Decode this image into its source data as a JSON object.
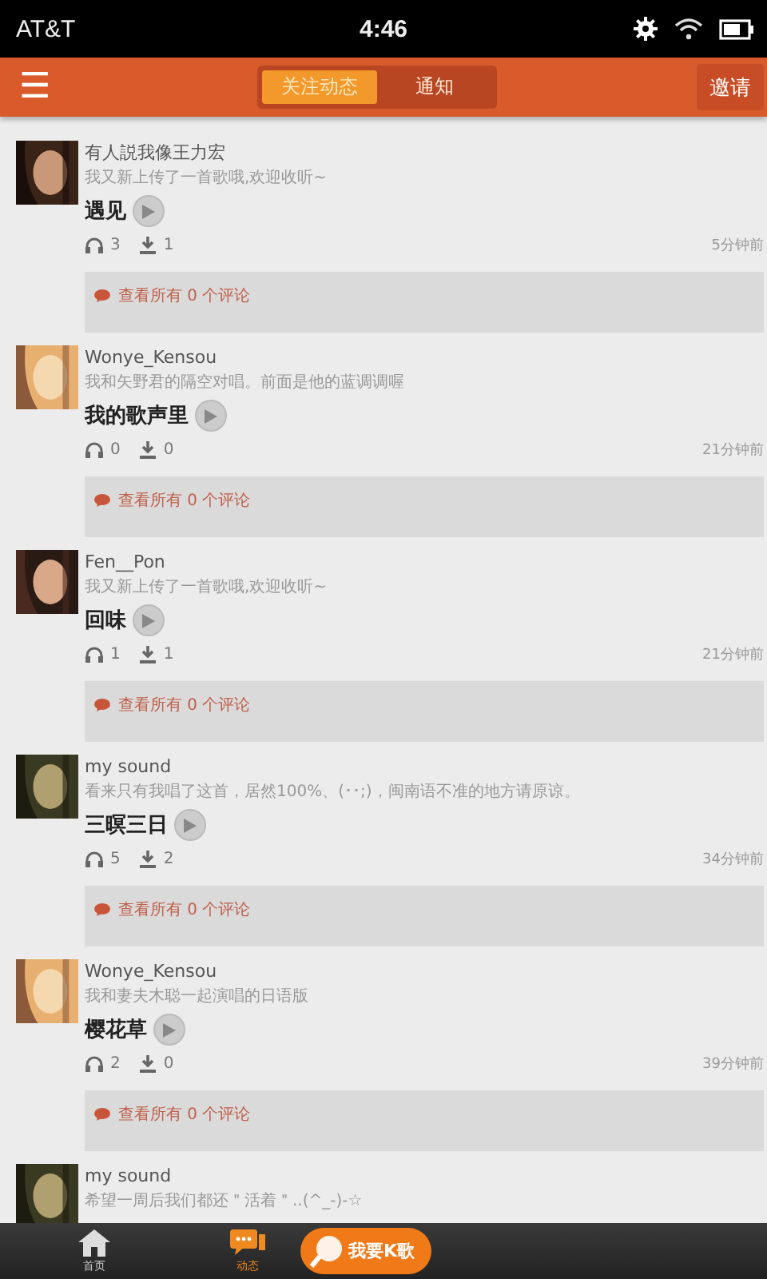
{
  "status_bar": {
    "carrier": "AT&T",
    "time": "4:46"
  },
  "header": {
    "menu_icon": "☰",
    "tabs": [
      {
        "label": "关注动态",
        "selected": true
      },
      {
        "label": "通知",
        "selected": false
      }
    ],
    "invite_button": "邀请"
  },
  "feed": [
    {
      "user": "有人説我像王力宏",
      "message": "我又新上传了一首歌哦,欢迎收听~",
      "song": "遇见",
      "listens": "3",
      "downloads": "1",
      "time": "5分钟前",
      "comments": "查看所有 0 个评论"
    },
    {
      "user": "Wonye_Kensou",
      "message": "我和矢野君的隔空对唱。前面是他的蓝调调喔",
      "song": "我的歌声里",
      "listens": "0",
      "downloads": "0",
      "time": "21分钟前",
      "comments": "查看所有 0 个评论"
    },
    {
      "user": "Fen__Pon",
      "message": "我又新上传了一首歌哦,欢迎收听~",
      "song": "回味",
      "listens": "1",
      "downloads": "1",
      "time": "21分钟前",
      "comments": "查看所有 0 个评论"
    },
    {
      "user": "my sound",
      "message": "看来只有我唱了这首，居然100%、(･･;)，闽南语不准的地方请原谅。",
      "song": "三暝三日",
      "listens": "5",
      "downloads": "2",
      "time": "34分钟前",
      "comments": "查看所有 0 个评论"
    },
    {
      "user": "Wonye_Kensou",
      "message": "我和妻夫木聪一起演唱的日语版",
      "song": "樱花草",
      "listens": "2",
      "downloads": "0",
      "time": "39分钟前",
      "comments": "查看所有 0 个评论"
    },
    {
      "user": "my sound",
      "message": "希望一周后我们都还＂活着＂..(^_-)-☆"
    }
  ],
  "bottom_nav": [
    {
      "kind": "tab",
      "label": "首页",
      "selected": false
    },
    {
      "kind": "tab",
      "label": "动态",
      "selected": true
    },
    {
      "kind": "action",
      "label": "我要K歌"
    }
  ]
}
